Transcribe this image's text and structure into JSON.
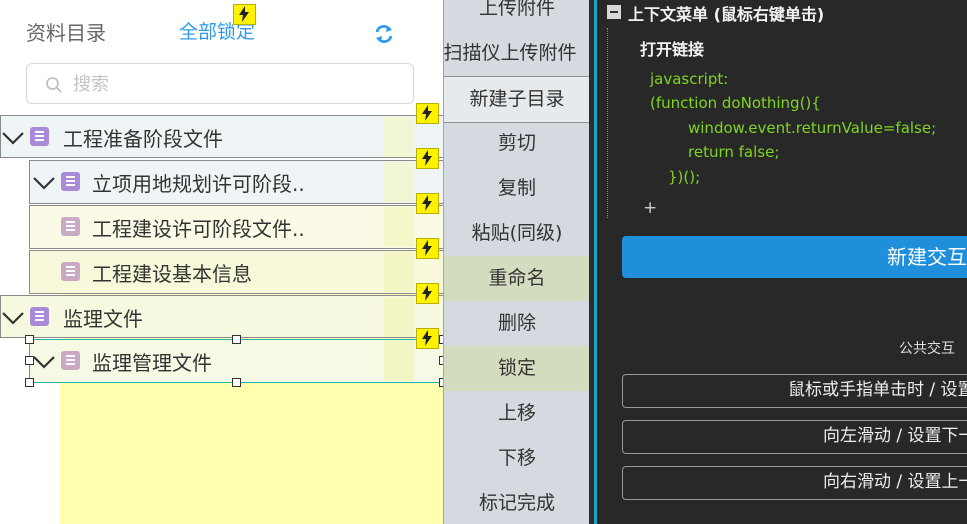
{
  "left": {
    "title": "资料目录",
    "lock_all": "全部锁定",
    "search_placeholder": "搜索",
    "tree": [
      {
        "label": "工程准备阶段文件"
      },
      {
        "label": "立项用地规划许可阶段.."
      },
      {
        "label": "工程建设许可阶段文件.."
      },
      {
        "label": "工程建设基本信息"
      },
      {
        "label": "监理文件"
      },
      {
        "label": "监理管理文件"
      }
    ]
  },
  "menu": {
    "items": [
      {
        "label": "上传附件"
      },
      {
        "label": "扫描仪上传附件"
      },
      {
        "label": "新建子目录"
      },
      {
        "label": "剪切"
      },
      {
        "label": "复制"
      },
      {
        "label": "粘贴(同级)"
      },
      {
        "label": "重命名"
      },
      {
        "label": "删除"
      },
      {
        "label": "锁定"
      },
      {
        "label": "上移"
      },
      {
        "label": "下移"
      },
      {
        "label": "标记完成"
      }
    ]
  },
  "right": {
    "header": "上下文菜单 (鼠标右键单击)",
    "action": "打开链接",
    "code": [
      "javascript:",
      "(function doNothing(){",
      "window.event.returnValue=false;",
      "return false;",
      "})();"
    ],
    "plus": "+",
    "new_interaction": "新建交互",
    "public_interaction": "公共交互",
    "buttons": [
      {
        "label": "鼠标或手指单击时 / 设置"
      },
      {
        "label": "向左滑动 / 设置下一"
      },
      {
        "label": "向右滑动 / 设置上一"
      }
    ]
  },
  "colors": {
    "accent_blue": "#2f9ae8",
    "highlight_yellow": "#ffffb0",
    "bolt_yellow": "#fff200",
    "code_green": "#7ed61f",
    "button_blue": "#1f8fdc",
    "panel_dark": "#282828",
    "selection_teal": "#24b2a6"
  },
  "icons": [
    "search-icon",
    "refresh-icon",
    "chevron-down-icon",
    "document-icon",
    "lightning-icon",
    "collapse-icon"
  ]
}
